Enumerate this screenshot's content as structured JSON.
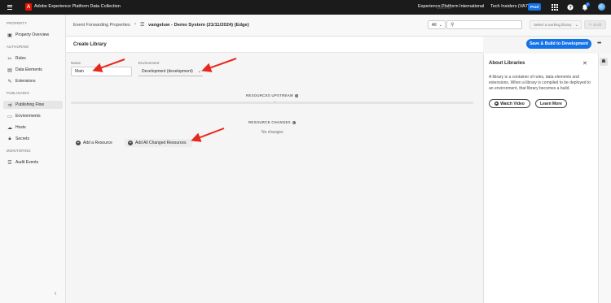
{
  "topbar": {
    "app_title": "Adobe Experience Platform Data Collection",
    "org": "Experience Platform International",
    "sandbox": "Tech Insiders (VA7)",
    "env_badge": "Prod",
    "notification_count": "2"
  },
  "sidebar": {
    "sections": [
      {
        "label": "PROPERTY"
      },
      {
        "label": "AUTHORING"
      },
      {
        "label": "PUBLISHING"
      },
      {
        "label": "MONITORING"
      }
    ],
    "items": [
      {
        "label": "Property Overview",
        "icon": "property-overview-icon"
      },
      {
        "label": "Rules",
        "icon": "rules-icon"
      },
      {
        "label": "Data Elements",
        "icon": "data-elements-icon"
      },
      {
        "label": "Extensions",
        "icon": "extensions-icon"
      },
      {
        "label": "Publishing Flow",
        "icon": "publishing-flow-icon",
        "active": true
      },
      {
        "label": "Environments",
        "icon": "environments-icon"
      },
      {
        "label": "Hosts",
        "icon": "hosts-icon"
      },
      {
        "label": "Secrets",
        "icon": "secrets-icon"
      },
      {
        "label": "Audit Events",
        "icon": "audit-events-icon"
      }
    ]
  },
  "breadcrumb": {
    "parent": "Event Forwarding Properties",
    "current": "vangeluw - Demo System (21/11/2024) (Edge)"
  },
  "toolbar": {
    "filter_value": "All",
    "search_placeholder": "",
    "library_placeholder": "Select a working library",
    "build_label": "Build"
  },
  "page": {
    "title": "Create Library",
    "cancel_label": "Cancel",
    "save_label": "Save & Build to Development"
  },
  "form": {
    "name_label": "Name",
    "name_value": "Main",
    "environment_label": "Environment",
    "environment_value": "Development (development)"
  },
  "resources": {
    "upstream_heading": "RESOURCES UPSTREAM",
    "changes_heading": "RESOURCE CHANGES",
    "no_changes": "No changes",
    "add_resource_label": "Add a Resource",
    "add_all_label": "Add All Changed Resources"
  },
  "about_panel": {
    "title": "About Libraries",
    "body": "A library is a container of rules, data elements and extensions. When a library is compiled to be deployed to an environment, that library becomes a build.",
    "watch_label": "Watch Video",
    "learn_label": "Learn More"
  },
  "colors": {
    "accent": "#1473e6",
    "annotation_arrow": "#e8281c",
    "topbar": "#1b1b1b",
    "adobe_red": "#eb1000"
  }
}
